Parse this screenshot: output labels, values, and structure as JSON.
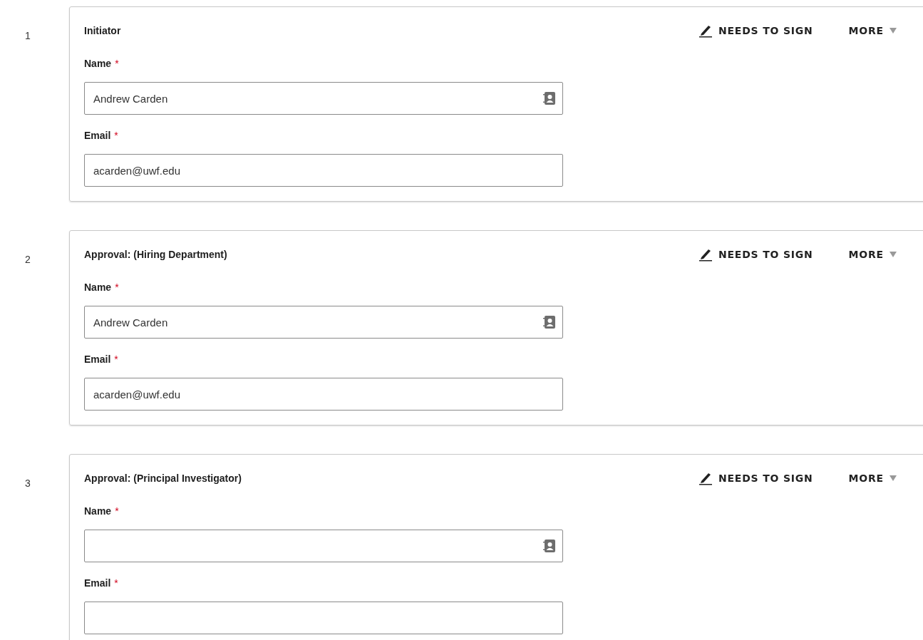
{
  "signers": [
    {
      "number": "1",
      "title": "Initiator",
      "action": "NEEDS TO SIGN",
      "more": "MORE",
      "fields": [
        {
          "kind": "contact",
          "label": "Name",
          "required_mark": "*",
          "value": "Andrew Carden"
        },
        {
          "kind": "text",
          "label": "Email",
          "required_mark": "*",
          "value": "acarden@uwf.edu"
        }
      ]
    },
    {
      "number": "2",
      "title": "Approval: (Hiring Department)",
      "action": "NEEDS TO SIGN",
      "more": "MORE",
      "fields": [
        {
          "kind": "contact",
          "label": "Name",
          "required_mark": "*",
          "value": "Andrew Carden"
        },
        {
          "kind": "text",
          "label": "Email",
          "required_mark": "*",
          "value": "acarden@uwf.edu"
        }
      ]
    },
    {
      "number": "3",
      "title": "Approval: (Principal Investigator)",
      "action": "NEEDS TO SIGN",
      "more": "MORE",
      "fields": [
        {
          "kind": "contact",
          "label": "Name",
          "required_mark": "*"
        },
        {
          "kind": "text",
          "label": "Email",
          "required_mark": "*"
        }
      ]
    }
  ]
}
